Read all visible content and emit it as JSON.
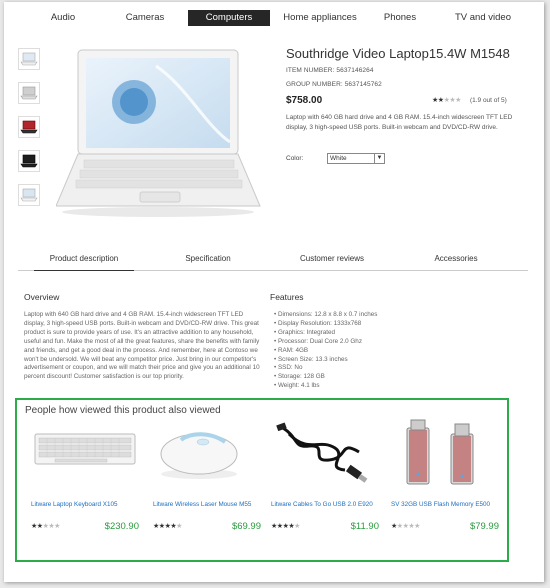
{
  "nav": {
    "items": [
      {
        "label": "Audio"
      },
      {
        "label": "Cameras"
      },
      {
        "label": "Computers"
      },
      {
        "label": "Home appliances"
      },
      {
        "label": "Phones"
      },
      {
        "label": "TV and video"
      }
    ],
    "active_index": 2
  },
  "product": {
    "title": "Southridge Video Laptop15.4W M1548",
    "item_number": "ITEM NUMBER: 5637146264",
    "group_number": "GROUP NUMBER: 5637145762",
    "price": "$758.00",
    "rating": {
      "stars_on": 2,
      "stars_total": 5,
      "text": "(1.9 out of 5)"
    },
    "description": "Laptop with 640 GB hard drive and 4 GB RAM. 15.4-inch widescreen TFT LED display, 3 high-speed USB ports. Built-in webcam and DVD/CD-RW drive.",
    "color_label": "Color:",
    "color_value": "White",
    "thumbnail_colors": [
      "#dfe9f3",
      "#cfcfcf",
      "#b0262c",
      "#1e1e1e",
      "#d8d8d8"
    ]
  },
  "tabs": [
    {
      "label": "Product description"
    },
    {
      "label": "Specification"
    },
    {
      "label": "Customer reviews"
    },
    {
      "label": "Accessories"
    }
  ],
  "overview": {
    "title": "Overview",
    "text": "Laptop with 640 GB hard drive and 4 GB RAM. 15.4-inch widescreen TFT LED display, 3 high-speed USB ports. Built-in webcam and DVD/CD-RW drive. This great product is sure to provide years of use. It's an attractive addition to any household, useful and fun. Make the most of all the great features, share the benefits with family and friends, and get a good deal in the process. And remember, here at Contoso we won't be undersold. We will beat any competitor price. Just bring in our competitor's advertisement or coupon, and we will match their price and give you an additional 10 percent discount! Customer satisfaction is our top priority."
  },
  "features": {
    "title": "Features",
    "items": [
      "Dimensions: 12.8 x 8.8 x 0.7 inches",
      "Display Resolution: 1333x768",
      "Graphics: Integrated",
      "Processor: Dual Core 2.0 Ghz",
      "RAM: 4GB",
      "Screen Size: 13.3 inches",
      "SSD: No",
      "Storage: 128 GB",
      "Weight: 4.1 lbs"
    ]
  },
  "also_viewed": {
    "title": "People how viewed this product also viewed",
    "items": [
      {
        "name": "Litware Laptop Keyboard X105",
        "price": "$230.90",
        "stars_on": 2,
        "icon": "keyboard-icon"
      },
      {
        "name": "Litware Wireless Laser Mouse M55",
        "price": "$69.99",
        "stars_on": 4,
        "icon": "mouse-icon"
      },
      {
        "name": "Litware Cables To Go USB 2.0 E920",
        "price": "$11.90",
        "stars_on": 4,
        "icon": "usb-cable-icon"
      },
      {
        "name": "SV 32GB USB Flash Memory E500",
        "price": "$79.99",
        "stars_on": 1,
        "icon": "usb-flash-drive-icon"
      }
    ]
  }
}
